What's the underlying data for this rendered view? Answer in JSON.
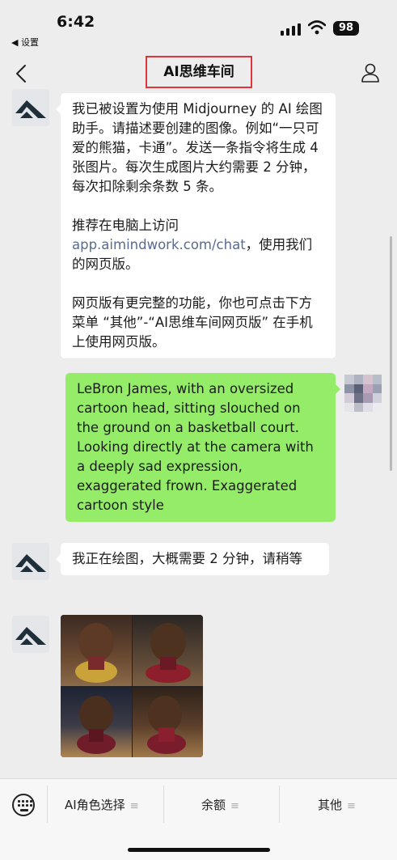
{
  "status_bar": {
    "time": "6:42",
    "back_app_label": "◀ 设置",
    "battery": "98"
  },
  "nav": {
    "title": "AI思维车间"
  },
  "messages": {
    "bot_intro": {
      "para1": "我已被设置为使用 Midjourney 的 AI 绘图助手。请描述要创建的图像。例如“一只可爱的熊猫，卡通”。发送一条指令将生成 4 张图片。每次生成图片大约需要 2 分钟，每次扣除剩余条数 5 条。",
      "para2_prefix": "推荐在电脑上访问",
      "para2_link": "app.aimindwork.com/chat",
      "para2_suffix": "，使用我们的网页版。",
      "para3": "网页版有更完整的功能，你也可点击下方菜单 “其他”-“AI思维车间网页版” 在手机上使用网页版。"
    },
    "user_prompt": "LeBron James, with an oversized cartoon head, sitting slouched on the ground on a basketball court. Looking directly at the camera with a deeply sad expression, exaggerated frown. Exaggerated cartoon style",
    "bot_drawing": "我正在绘图，大概需要 2 分钟，请稍等"
  },
  "menu": {
    "items": [
      {
        "label": "AI角色选择"
      },
      {
        "label": "余额"
      },
      {
        "label": "其他"
      }
    ]
  },
  "colors": {
    "background": "#ededed",
    "green_bubble": "#95ec69",
    "link": "#576b95",
    "title_highlight": "#e3343c"
  }
}
